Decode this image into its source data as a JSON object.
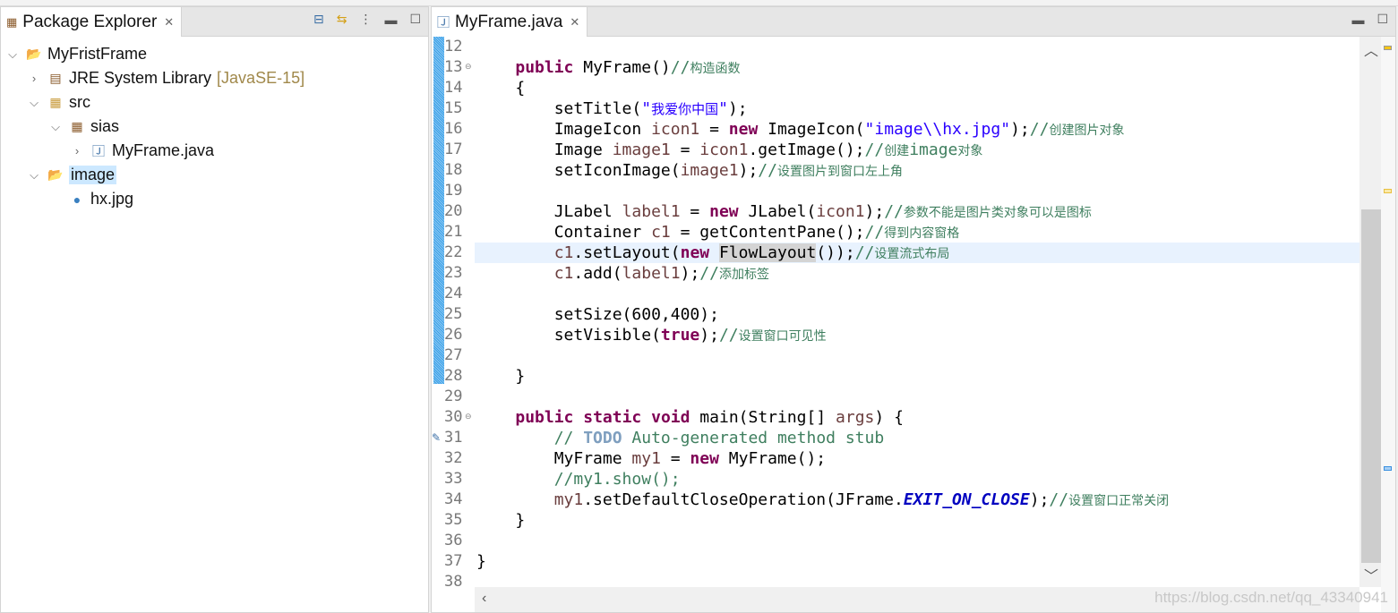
{
  "explorer": {
    "title": "Package Explorer",
    "tree": [
      {
        "label": "MyFristFrame",
        "depth": 0,
        "twisty": "expanded",
        "icon": "project-icon"
      },
      {
        "label": "JRE System Library",
        "decoration": "[JavaSE-15]",
        "depth": 1,
        "twisty": "collapsed",
        "icon": "library-icon"
      },
      {
        "label": "src",
        "depth": 1,
        "twisty": "expanded",
        "icon": "source-folder-icon"
      },
      {
        "label": "sias",
        "depth": 2,
        "twisty": "expanded",
        "icon": "package-icon"
      },
      {
        "label": "MyFrame.java",
        "depth": 3,
        "twisty": "collapsed",
        "icon": "java-file-icon"
      },
      {
        "label": "image",
        "depth": 1,
        "twisty": "expanded",
        "icon": "folder-icon",
        "selected": true
      },
      {
        "label": "hx.jpg",
        "depth": 2,
        "twisty": "none",
        "icon": "image-file-icon"
      }
    ]
  },
  "editor": {
    "tab": "MyFrame.java",
    "current_line": 22,
    "lines": [
      {
        "n": 12,
        "t": []
      },
      {
        "n": 13,
        "fold": true,
        "t": [
          [
            "    ",
            ""
          ],
          [
            "public",
            "kw"
          ],
          [
            " MyFrame()",
            ""
          ],
          [
            "//",
            "cm"
          ],
          [
            "构造函数",
            "cmz"
          ]
        ]
      },
      {
        "n": 14,
        "t": [
          [
            "    {",
            ""
          ]
        ]
      },
      {
        "n": 15,
        "t": [
          [
            "        setTitle(",
            ""
          ],
          [
            "\"",
            "str"
          ],
          [
            "我爱你中国",
            "strz"
          ],
          [
            "\"",
            "str"
          ],
          [
            ");",
            ""
          ]
        ]
      },
      {
        "n": 16,
        "t": [
          [
            "        ImageIcon ",
            ""
          ],
          [
            "icon1",
            "var"
          ],
          [
            " = ",
            ""
          ],
          [
            "new",
            "kw"
          ],
          [
            " ImageIcon(",
            ""
          ],
          [
            "\"image\\\\hx.jpg\"",
            "str"
          ],
          [
            ");",
            ""
          ],
          [
            "//",
            "cm"
          ],
          [
            "创建图片对象",
            "cmz"
          ]
        ]
      },
      {
        "n": 17,
        "t": [
          [
            "        Image ",
            ""
          ],
          [
            "image1",
            "var"
          ],
          [
            " = ",
            ""
          ],
          [
            "icon1",
            "var"
          ],
          [
            ".getImage();",
            ""
          ],
          [
            "//",
            "cm"
          ],
          [
            "创建",
            "cmz"
          ],
          [
            "image",
            "cm"
          ],
          [
            "对象",
            "cmz"
          ]
        ]
      },
      {
        "n": 18,
        "t": [
          [
            "        setIconImage(",
            ""
          ],
          [
            "image1",
            "var"
          ],
          [
            ");",
            ""
          ],
          [
            "//",
            "cm"
          ],
          [
            "设置图片到窗口左上角",
            "cmz"
          ]
        ]
      },
      {
        "n": 19,
        "t": []
      },
      {
        "n": 20,
        "t": [
          [
            "        JLabel ",
            ""
          ],
          [
            "label1",
            "var"
          ],
          [
            " = ",
            ""
          ],
          [
            "new",
            "kw"
          ],
          [
            " JLabel(",
            ""
          ],
          [
            "icon1",
            "var"
          ],
          [
            ");",
            ""
          ],
          [
            "//",
            "cm"
          ],
          [
            "参数不能是图片类对象可以是图标",
            "cmz"
          ]
        ]
      },
      {
        "n": 21,
        "t": [
          [
            "        Container ",
            ""
          ],
          [
            "c1",
            "var"
          ],
          [
            " = getContentPane();",
            ""
          ],
          [
            "//",
            "cm"
          ],
          [
            "得到内容窗格",
            "cmz"
          ]
        ]
      },
      {
        "n": 22,
        "t": [
          [
            "        ",
            ""
          ],
          [
            "c1",
            "var"
          ],
          [
            ".setLayout(",
            ""
          ],
          [
            "new",
            "kw"
          ],
          [
            " ",
            ""
          ],
          [
            "FlowLayout",
            "occ"
          ],
          [
            "());",
            ""
          ],
          [
            "//",
            "cm"
          ],
          [
            "设置流式布局",
            "cmz"
          ]
        ]
      },
      {
        "n": 23,
        "t": [
          [
            "        ",
            ""
          ],
          [
            "c1",
            "var"
          ],
          [
            ".add(",
            ""
          ],
          [
            "label1",
            "var"
          ],
          [
            ");",
            ""
          ],
          [
            "//",
            "cm"
          ],
          [
            "添加标签",
            "cmz"
          ]
        ]
      },
      {
        "n": 24,
        "t": []
      },
      {
        "n": 25,
        "t": [
          [
            "        setSize(600,400);",
            ""
          ]
        ]
      },
      {
        "n": 26,
        "t": [
          [
            "        setVisible(",
            ""
          ],
          [
            "true",
            "kw"
          ],
          [
            ");",
            ""
          ],
          [
            "//",
            "cm"
          ],
          [
            "设置窗口可见性",
            "cmz"
          ]
        ]
      },
      {
        "n": 27,
        "t": []
      },
      {
        "n": 28,
        "t": [
          [
            "    }",
            ""
          ]
        ]
      },
      {
        "n": 29,
        "t": []
      },
      {
        "n": 30,
        "fold": true,
        "t": [
          [
            "    ",
            ""
          ],
          [
            "public",
            "kw"
          ],
          [
            " ",
            ""
          ],
          [
            "static",
            "kw"
          ],
          [
            " ",
            ""
          ],
          [
            "void",
            "kw"
          ],
          [
            " main(String[] ",
            ""
          ],
          [
            "args",
            "var"
          ],
          [
            ") {",
            ""
          ]
        ]
      },
      {
        "n": 31,
        "task": true,
        "t": [
          [
            "        // ",
            "cm"
          ],
          [
            "TODO",
            "todo"
          ],
          [
            " Auto-generated method stub",
            "cm"
          ]
        ]
      },
      {
        "n": 32,
        "t": [
          [
            "        MyFrame ",
            ""
          ],
          [
            "my1",
            "var"
          ],
          [
            " = ",
            ""
          ],
          [
            "new",
            "kw"
          ],
          [
            " MyFrame();",
            ""
          ]
        ]
      },
      {
        "n": 33,
        "t": [
          [
            "        //my1.show();",
            "cm"
          ]
        ]
      },
      {
        "n": 34,
        "t": [
          [
            "        ",
            ""
          ],
          [
            "my1",
            "var"
          ],
          [
            ".setDefaultCloseOperation(JFrame.",
            ""
          ],
          [
            "EXIT_ON_CLOSE",
            "fld"
          ],
          [
            ");",
            ""
          ],
          [
            "//",
            "cm"
          ],
          [
            "设置窗口正常关闭",
            "cmz"
          ]
        ]
      },
      {
        "n": 35,
        "t": [
          [
            "    }",
            ""
          ]
        ]
      },
      {
        "n": 36,
        "t": []
      },
      {
        "n": 37,
        "t": [
          [
            "}",
            ""
          ]
        ]
      },
      {
        "n": 38,
        "t": []
      }
    ]
  },
  "watermark": "https://blog.csdn.net/qq_43340941",
  "colors": {
    "keyword": "#7f0055",
    "string": "#2a00ff",
    "comment": "#3f7f5f",
    "selection": "#cce8ff",
    "current_line": "#e8f2fe"
  }
}
